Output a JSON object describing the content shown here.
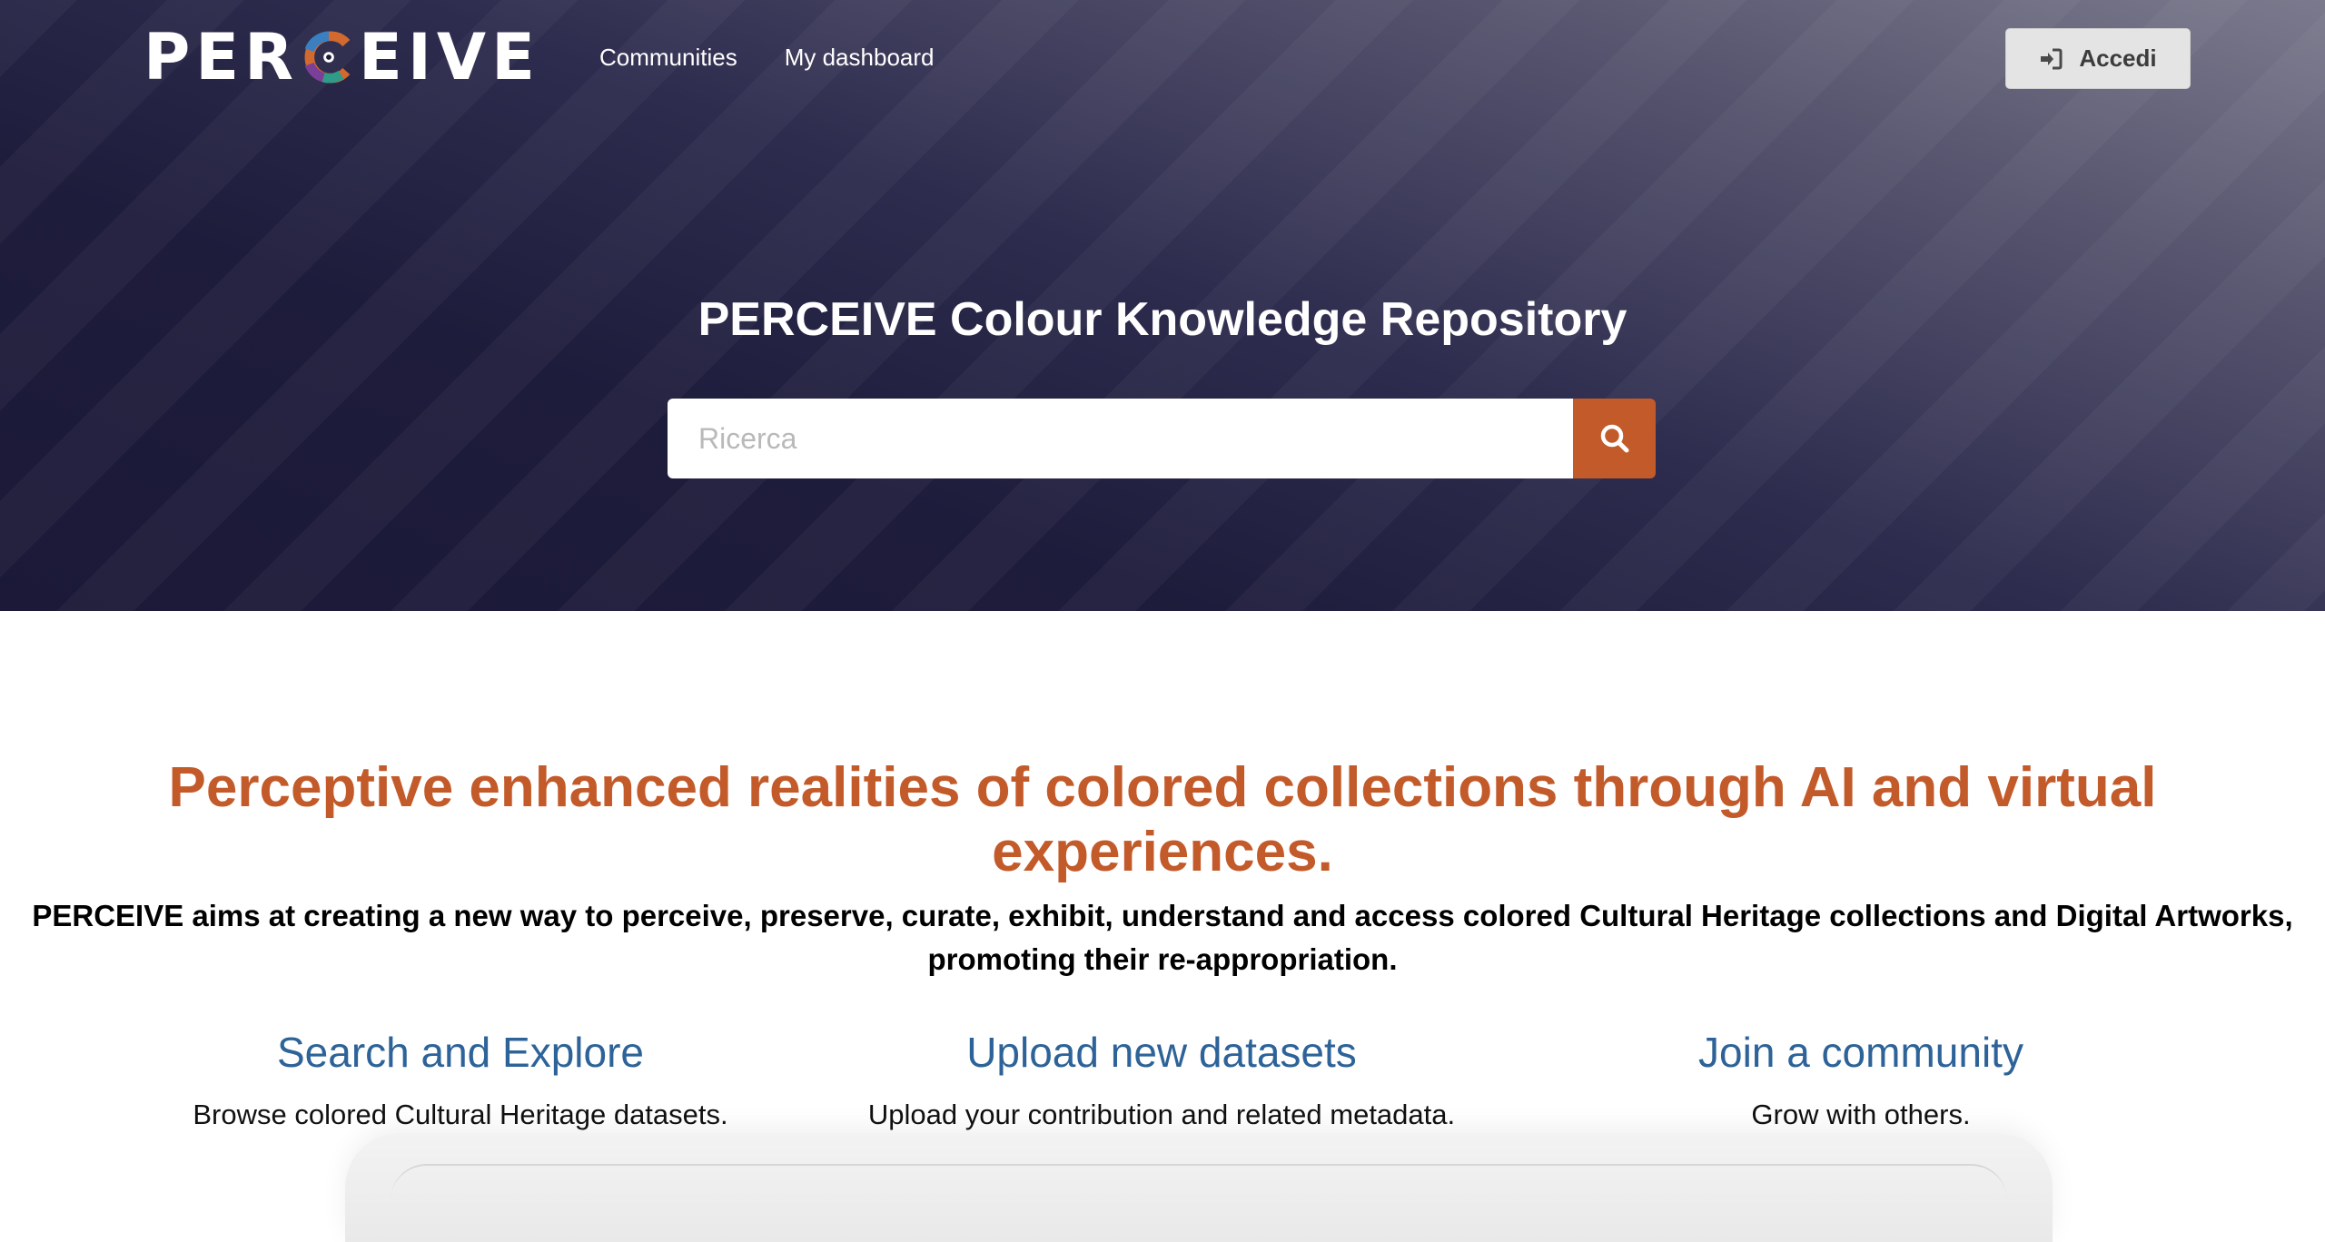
{
  "header": {
    "logo_text_left": "PER",
    "logo_text_right": "EIVE",
    "nav": [
      {
        "label": "Communities"
      },
      {
        "label": "My dashboard"
      }
    ],
    "login_label": "Accedi",
    "login_icon": "sign-in-icon"
  },
  "hero": {
    "title": "PERCEIVE Colour Knowledge Repository",
    "search_placeholder": "Ricerca",
    "search_icon": "search-icon"
  },
  "main": {
    "tagline": "Perceptive enhanced realities of colored collections through AI and virtual experiences.",
    "intro": "PERCEIVE aims at creating a new way to perceive, preserve, curate, exhibit, understand and access colored Cultural Heritage collections and Digital Artworks, promoting their re-appropriation.",
    "features": [
      {
        "title": "Search and Explore",
        "text": "Browse colored Cultural Heritage datasets."
      },
      {
        "title": "Upload new datasets",
        "text": "Upload your contribution and related metadata."
      },
      {
        "title": "Join a community",
        "text": "Grow with others."
      }
    ]
  },
  "colors": {
    "accent": "#c35a2a",
    "link": "#2d6398",
    "hero_dark": "#1e1c3b"
  }
}
